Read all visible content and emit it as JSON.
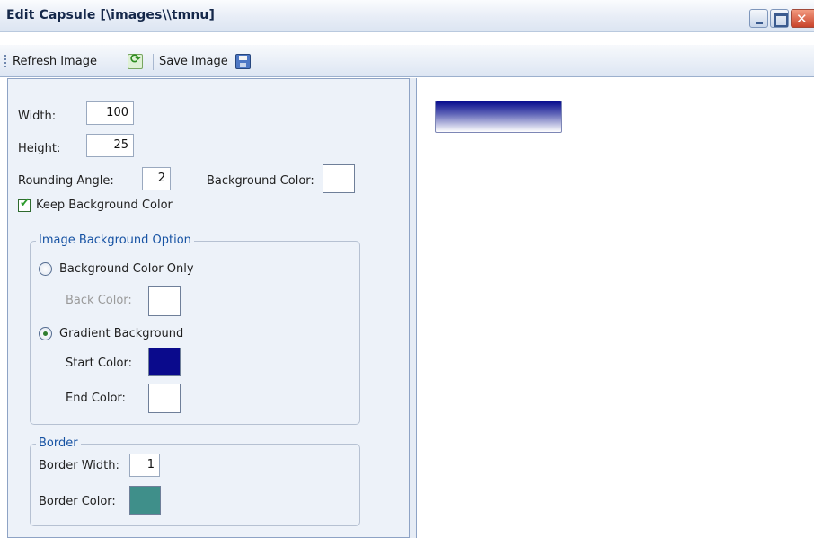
{
  "window": {
    "title": "Edit Capsule [\\images\\\\tmnu]",
    "buttons": [
      "minimize-icon",
      "maximize-icon",
      "close-icon"
    ]
  },
  "toolbar": {
    "refresh_label": "Refresh Image",
    "refresh_icon": "refresh-icon",
    "save_label": "Save Image",
    "save_icon": "floppy-disk-icon"
  },
  "form": {
    "width_label": "Width:",
    "width_value": "100",
    "height_label": "Height:",
    "height_value": "25",
    "rounding_label": "Rounding Angle:",
    "rounding_value": "2",
    "background_color_label": "Background Color:",
    "background_color": "#ffffff",
    "keep_background_label": "Keep Background Color",
    "keep_background_checked": true
  },
  "image_background": {
    "title": "Image Background Option",
    "option_solid_label": "Background Color Only",
    "option_solid_selected": false,
    "back_color_label": "Back Color:",
    "back_color": "#ffffff",
    "option_gradient_label": "Gradient Background",
    "option_gradient_selected": true,
    "start_color_label": "Start Color:",
    "start_color": "#0a0a8c",
    "end_color_label": "End Color:",
    "end_color": "#ffffff"
  },
  "border": {
    "title": "Border",
    "width_label": "Border Width:",
    "width_value": "1",
    "color_label": "Border Color:",
    "color": "#3f8f8a"
  },
  "preview": {
    "gradient_start": "#0a0a8c",
    "gradient_end": "#ffffff"
  }
}
